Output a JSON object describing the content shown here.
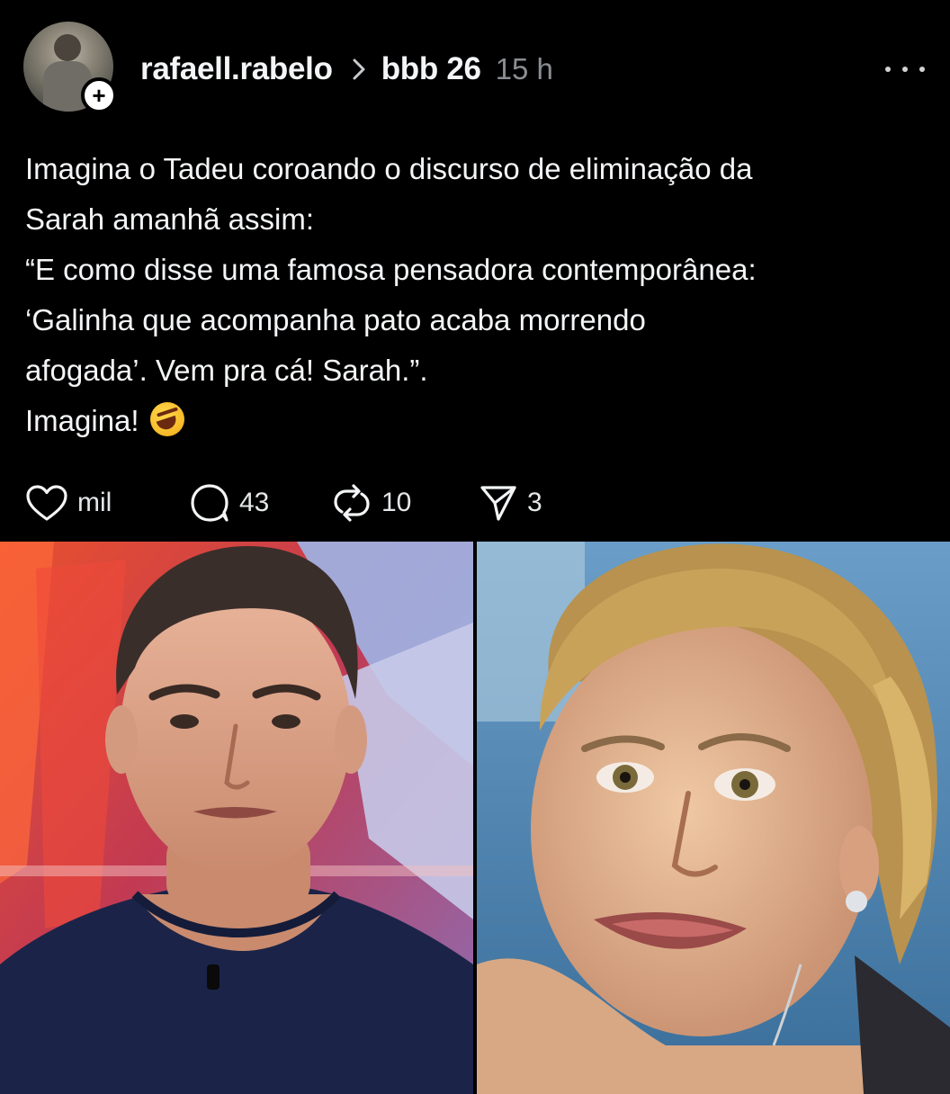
{
  "header": {
    "username": "rafaell.rabelo",
    "topic": "bbb 26",
    "time": "15 h",
    "follow_symbol": "+",
    "avatar_icon": "user-avatar",
    "more_icon": "more-options-icon"
  },
  "post": {
    "lines": [
      "Imagina o Tadeu coroando o discurso de eliminação da",
      "Sarah amanhã assim:",
      "“E como disse uma famosa pensadora contemporânea:",
      "‘Galinha que acompanha pato acaba morrendo",
      "afogada’. Vem pra cá! Sarah.”.",
      "Imagina!"
    ],
    "emoji": "rolling-on-floor-laughing-emoji"
  },
  "actions": {
    "likes": "mil",
    "comments": "43",
    "reposts": "10",
    "shares": "3"
  },
  "media": {
    "images": [
      {
        "name": "man-in-studio-photo"
      },
      {
        "name": "woman-closeup-photo"
      }
    ]
  },
  "colors": {
    "background": "#000000",
    "text": "#f3f5f7",
    "muted": "#8a8d91"
  }
}
